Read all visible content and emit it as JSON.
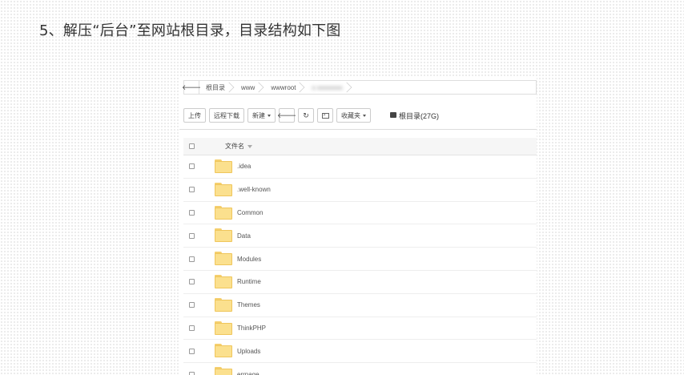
{
  "heading": "5、解压“后台”至网站根目录，目录结构如下图",
  "breadcrumb": {
    "back_icon": "arrow-left-icon",
    "items": [
      "根目录",
      "www",
      "wwwroot",
      "s"
    ]
  },
  "toolbar": {
    "upload": "上传",
    "remote_download": "远程下载",
    "new": "新建",
    "back_icon": "arrow-left-icon",
    "refresh_icon": "refresh-icon",
    "terminal_icon": "terminal-icon",
    "favorites": "收藏夹",
    "disk_label": "根目录(27G)"
  },
  "table": {
    "header_name": "文件名",
    "rows": [
      ".idea",
      ".well-known",
      "Common",
      "Data",
      "Modules",
      "Runtime",
      "Themes",
      "ThinkPHP",
      "Uploads",
      "errpage"
    ]
  },
  "colors": {
    "folder": "#fbe08e",
    "folder_border": "#efc65c"
  }
}
